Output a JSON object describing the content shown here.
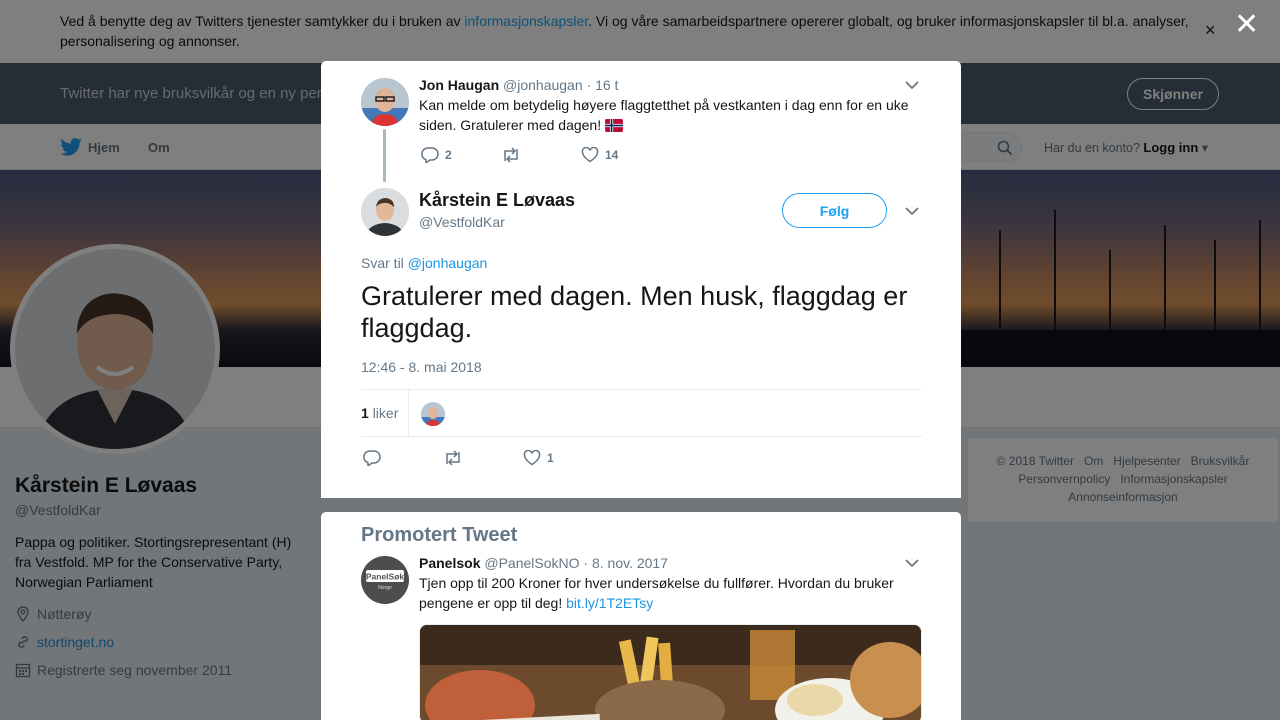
{
  "cookie_banner": {
    "text_before": "Ved å benytte deg av Twitters tjenester samtykker du i bruken av ",
    "link": "informasjonskapsler",
    "text_after": ". Vi og våre samarbeidspartnere opererer globalt, og bruker informasjonskapsler til bl.a. analyser, personalisering og annonser.",
    "close": "×"
  },
  "terms_banner": {
    "text": "Twitter har nye bruksvilkår og en ny personvernpolicy",
    "button": "Skjønner"
  },
  "nav": {
    "home": "Hjem",
    "about": "Om",
    "account_prompt": "Har du en konto?",
    "login": "Logg inn"
  },
  "profile": {
    "name": "Kårstein E Løvaas",
    "handle": "@VestfoldKar",
    "bio": "Pappa og politiker. Stortingsrepresentant (H) fra Vestfold. MP for the Conservative Party, Norwegian Parliament",
    "location": "Nøtterøy",
    "website": "stortinget.no",
    "joined": "Registrerte seg november 2011"
  },
  "footer": {
    "links": [
      "© 2018 Twitter",
      "Om",
      "Hjelpesenter",
      "Bruksvilkår",
      "Personvernpolicy",
      "Informasjonskapsler",
      "Annonseinformasjon"
    ]
  },
  "overlay": {
    "close": "✕"
  },
  "parent_tweet": {
    "name": "Jon Haugan",
    "handle": "@jonhaugan",
    "time": "· 16 t",
    "text": "Kan melde om betydelig høyere flaggtetthet på vestkanten i dag enn for en uke siden. Gratulerer med dagen!",
    "flag": "NO",
    "replies": "2",
    "likes": "14"
  },
  "main_tweet": {
    "name": "Kårstein E Løvaas",
    "handle": "@VestfoldKar",
    "follow": "Følg",
    "reply_prefix": "Svar til",
    "reply_to": "@jonhaugan",
    "text": "Gratulerer med dagen. Men husk, flaggdag er flaggdag.",
    "timestamp": "12:46 - 8. mai 2018",
    "likes_count": "1",
    "likes_label": "liker",
    "action_likes": "1"
  },
  "promoted": {
    "title": "Promotert Tweet",
    "name": "Panelsok",
    "handle": "@PanelSokNO",
    "time": "· 8. nov. 2017",
    "text": "Tjen opp til 200 Kroner for hver undersøkelse du fullfører. Hvordan du bruker pengene er opp til deg! ",
    "link": "bit.ly/1T2ETsy",
    "avatar_text_1": "PanelSøk",
    "avatar_text_2": "Norge"
  },
  "colors": {
    "accent": "#1da1f2",
    "link": "#1b95e0",
    "secondary_text": "#657786",
    "flag_red": "#ba0c2f",
    "flag_blue": "#00205b"
  }
}
